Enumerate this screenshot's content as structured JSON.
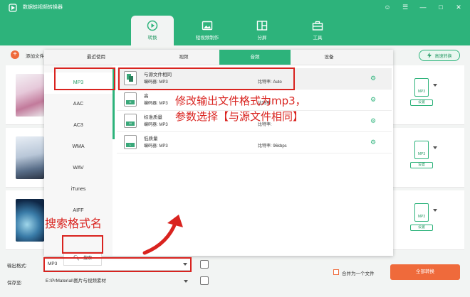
{
  "app": {
    "title": "数据蛙视频转换器",
    "window_controls": [
      "☺",
      "☰",
      "—",
      "□",
      "✕"
    ]
  },
  "nav": {
    "tabs": [
      {
        "label": "转换"
      },
      {
        "label": "短视频制作"
      },
      {
        "label": "分屏"
      },
      {
        "label": "工具"
      }
    ]
  },
  "toolbar": {
    "add_label": "添加文件",
    "speed_label": "高速转换"
  },
  "panel": {
    "categories": [
      "最近使用",
      "视频",
      "音频",
      "设备"
    ],
    "formats": [
      "MP3",
      "AAC",
      "AC3",
      "WMA",
      "WAV",
      "iTunes",
      "AIFF"
    ],
    "search_label": "搜索",
    "presets": [
      {
        "name": "与源文件相同",
        "encoder": "编码器:  MP3",
        "bitrate": "比特率:  Auto",
        "tag": ""
      },
      {
        "name": "高",
        "encoder": "编码器:  MP3",
        "bitrate": "比特率:",
        "tag": "H"
      },
      {
        "name": "标准质量",
        "encoder": "编码器:  MP3",
        "bitrate": "比特率:",
        "tag": "M"
      },
      {
        "name": "低质量",
        "encoder": "编码器:  MP3",
        "bitrate": "比特率:      96kbps",
        "tag": "L"
      }
    ]
  },
  "rows": {
    "format_name": "MP3",
    "settings_label": "设置"
  },
  "bottom": {
    "output_label": "输出格式:",
    "output_value": "MP3",
    "save_label": "保存至:",
    "save_path": "E:\\PrMaterial\\图片与视频素材",
    "merge_label": "合并为一个文件",
    "convert_label": "全部转换"
  },
  "annotations": {
    "main_text_line1": "修改输出文件格式为mp3，",
    "main_text_line2": "参数选择【与源文件相同】",
    "search_text": "搜索格式名"
  },
  "colors": {
    "brand_green": "#2db37b",
    "accent_orange": "#ef6a3b",
    "annotation_red": "#d9231f"
  }
}
